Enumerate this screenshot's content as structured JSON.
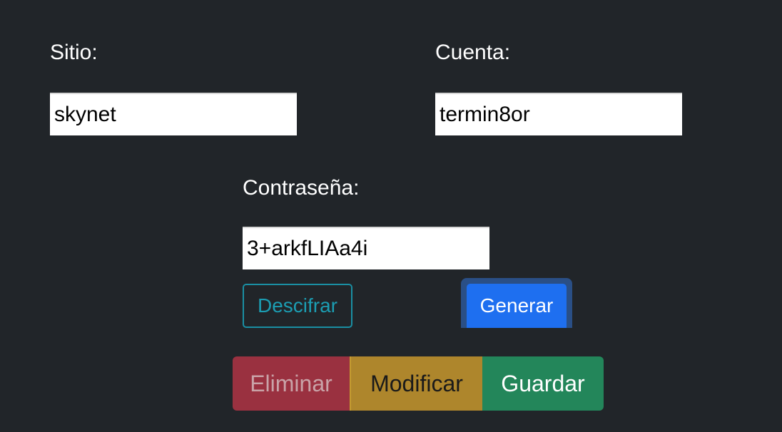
{
  "form": {
    "site": {
      "label": "Sitio:",
      "value": "skynet"
    },
    "account": {
      "label": "Cuenta:",
      "value": "termin8or"
    },
    "password": {
      "label": "Contraseña:",
      "value": "3+arkfLIAa4i"
    }
  },
  "actions": {
    "decrypt_label": "Descifrar",
    "generate_label": "Generar"
  },
  "crud": {
    "delete_label": "Eliminar",
    "modify_label": "Modificar",
    "save_label": "Guardar"
  },
  "colors": {
    "background": "#212529",
    "info": "#1c9db2",
    "primary": "#1e6ff0",
    "danger": "#9a3140",
    "warning": "#ae862c",
    "success": "#23865a"
  }
}
